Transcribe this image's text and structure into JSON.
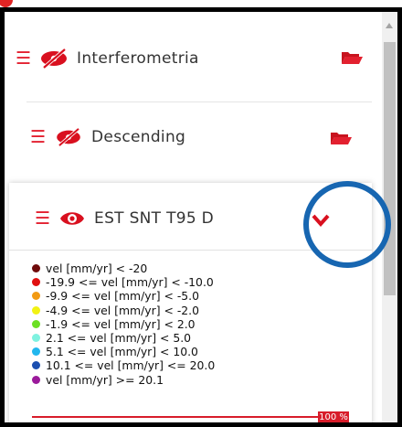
{
  "layers": {
    "group1": {
      "label": "Interferometria",
      "toggle_icon": "eye-off-icon",
      "folder_icon": "folder-open-icon"
    },
    "group2": {
      "label": "Descending",
      "toggle_icon": "eye-off-icon",
      "folder_icon": "folder-open-icon"
    },
    "layer": {
      "label": "EST SNT T95 D",
      "toggle_icon": "eye-icon",
      "expand_icon": "chevron-down-icon"
    }
  },
  "legend": [
    {
      "text": "vel [mm/yr] < -20",
      "color": "#6f0b0b"
    },
    {
      "text": "-19.9 <= vel [mm/yr] < -10.0",
      "color": "#e01010"
    },
    {
      "text": "-9.9 <= vel [mm/yr] < -5.0",
      "color": "#f29a13"
    },
    {
      "text": "-4.9 <= vel [mm/yr] < -2.0",
      "color": "#f2f213"
    },
    {
      "text": "-1.9 <= vel [mm/yr] < 2.0",
      "color": "#6ce023"
    },
    {
      "text": "2.1 <= vel [mm/yr] < 5.0",
      "color": "#7ff2e0"
    },
    {
      "text": "5.1 <= vel [mm/yr] < 10.0",
      "color": "#22b7ee"
    },
    {
      "text": "10.1 <= vel [mm/yr] <= 20.0",
      "color": "#1b4fb0"
    },
    {
      "text": "vel [mm/yr] >= 20.1",
      "color": "#9b1a9b"
    }
  ],
  "opacity": {
    "label": "100 %",
    "value_percent": 100
  },
  "colors": {
    "accent": "#e3202f",
    "highlight_ring": "#1766b1"
  }
}
